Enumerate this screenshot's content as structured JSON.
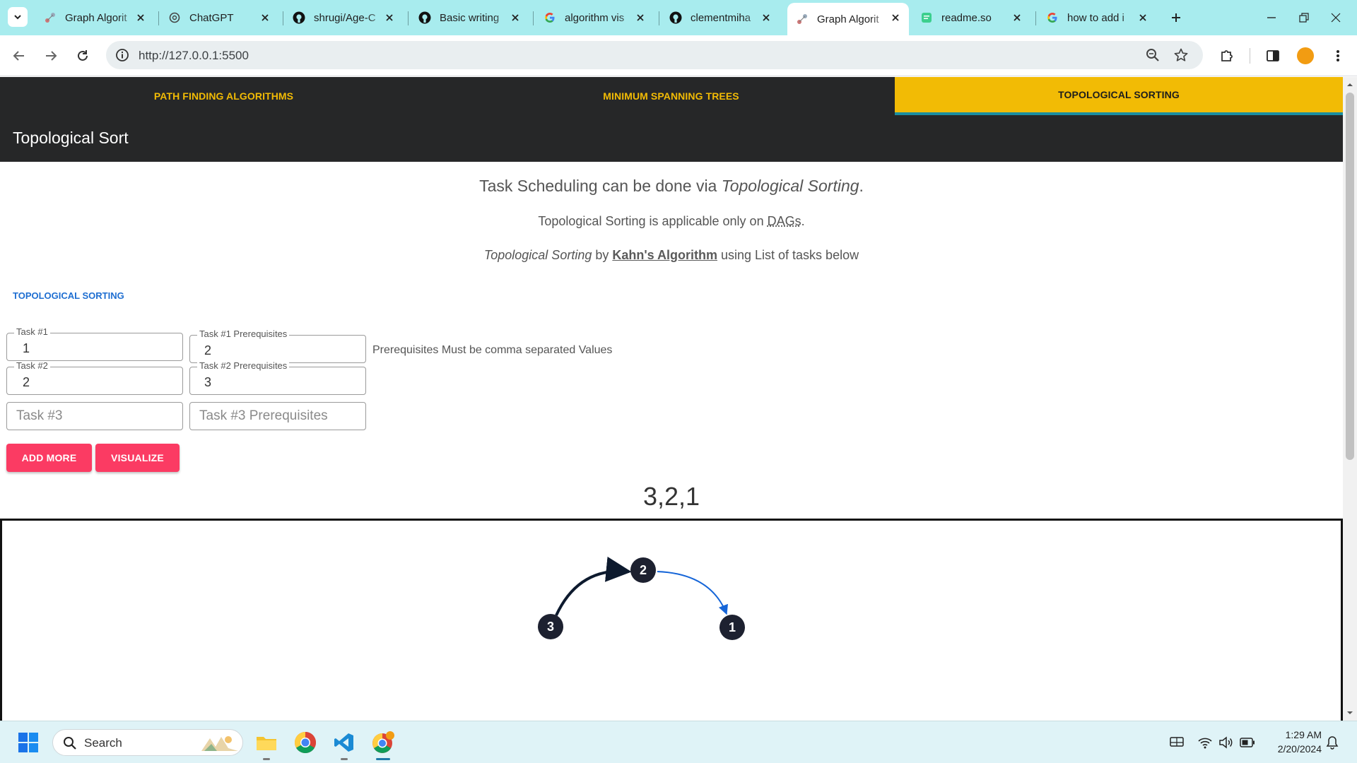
{
  "browser": {
    "tabs": [
      {
        "title": "Graph Algorit",
        "icon": "graph-favicon-icon"
      },
      {
        "title": "ChatGPT",
        "icon": "chatgpt-icon"
      },
      {
        "title": "shrugi/Age-C",
        "icon": "github-icon"
      },
      {
        "title": "Basic writing",
        "icon": "github-icon"
      },
      {
        "title": "algorithm vis",
        "icon": "google-icon"
      },
      {
        "title": "clementmiha",
        "icon": "github-icon"
      },
      {
        "title": "Graph Algorit",
        "icon": "graph-favicon-icon",
        "active": true
      },
      {
        "title": "readme.so",
        "icon": "readme-icon"
      },
      {
        "title": "how to add i",
        "icon": "google-icon"
      }
    ],
    "url": "http://127.0.0.1:5500"
  },
  "nav": {
    "tabs": [
      {
        "label": "PATH FINDING ALGORITHMS"
      },
      {
        "label": "MINIMUM SPANNING TREES"
      },
      {
        "label": "TOPOLOGICAL SORTING",
        "active": true
      }
    ],
    "title": "Topological Sort"
  },
  "intro": {
    "line1_a": "Task Scheduling can be done via ",
    "line1_em": "Topological Sorting",
    "line1_b": ".",
    "line2_a": "Topological Sorting is applicable only on ",
    "line2_abbr": "DAGs",
    "line2_b": ".",
    "line3_em": "Topological Sorting",
    "line3_a": " by ",
    "line3_link": "Kahn's Algorithm",
    "line3_b": " using List of tasks below"
  },
  "form": {
    "section_label": "TOPOLOGICAL SORTING",
    "rows": [
      {
        "task_label": "Task #1",
        "task_value": "1",
        "prereq_label": "Task #1 Prerequisites",
        "prereq_value": "2"
      },
      {
        "task_label": "Task #2",
        "task_value": "2",
        "prereq_label": "Task #2 Prerequisites",
        "prereq_value": "3"
      }
    ],
    "empty_row": {
      "task_placeholder": "Task #3",
      "prereq_placeholder": "Task #3 Prerequisites"
    },
    "hint": "Prerequisites Must be comma separated Values",
    "add_more_label": "ADD MORE",
    "visualize_label": "VISUALIZE"
  },
  "result": "3,2,1",
  "graph": {
    "nodes": [
      {
        "id": "3"
      },
      {
        "id": "2"
      },
      {
        "id": "1"
      }
    ],
    "edges": [
      {
        "from": "3",
        "to": "2"
      },
      {
        "from": "2",
        "to": "1"
      }
    ]
  },
  "taskbar": {
    "search_label": "Search",
    "time": "1:29 AM",
    "date": "2/20/2024"
  },
  "colors": {
    "tabstrip": "#a8ecee",
    "navbar": "#262728",
    "accent_yellow": "#f2bb05",
    "button_pink": "#fb3b63",
    "section_blue": "#1e6ed1"
  }
}
